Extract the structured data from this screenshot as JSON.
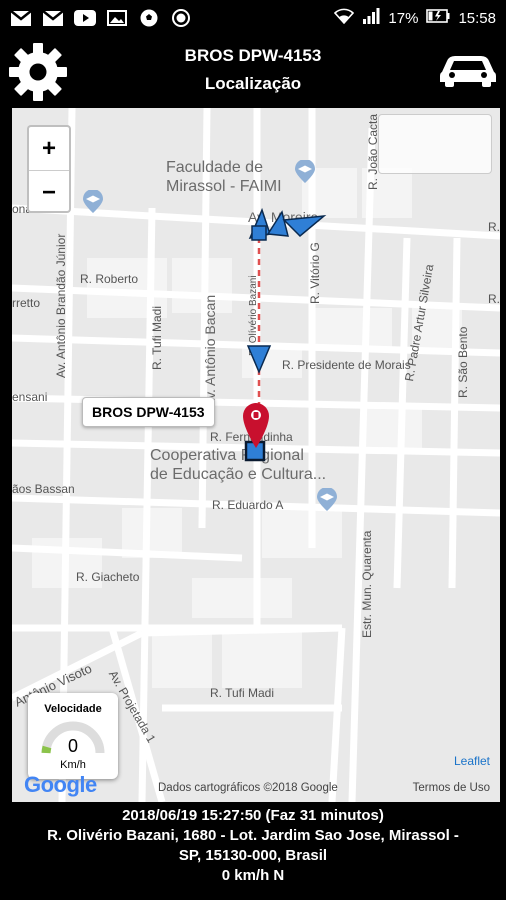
{
  "status_bar": {
    "left_icons": [
      "gmail-icon",
      "gmail-icon",
      "youtube-icon",
      "photos-icon",
      "soccer-ball-icon",
      "circle-app-icon"
    ],
    "battery": "17%",
    "time": "15:58"
  },
  "header": {
    "title": "BROS DPW-4153",
    "subtitle": "Localização"
  },
  "map": {
    "zoom_in": "+",
    "zoom_out": "−",
    "watermark": "",
    "poi": [
      {
        "name": "Faculdade de\nMirassol - FAIMI"
      },
      {
        "name": "Cooperativa Regional\nde Educação e Cultura..."
      }
    ],
    "streets": [
      "R. Roberto",
      "R. Tufi Madi",
      "Av. Antônio Brandão Júnior",
      "Av. Antônio Bacan",
      "R. Olívério Bazani",
      "R. Vitório G",
      "R. João Cacta",
      "R. Presidente de Morais",
      "R. Padre Artur Silveira",
      "R. São Bento",
      "R. Eduardo A",
      "Estr. Mun. Quarenta",
      "R. Tufi Madi",
      "Av. Projetada 1",
      "Antônio Visoto",
      "R. Giacheto",
      "Av. Moreira",
      "R. Fernandinha",
      "onarco",
      "rretto",
      "ensani",
      "ãos Bassan",
      "R."
    ],
    "marker_tooltip": "BROS DPW-4153",
    "speed_widget": {
      "label": "Velocidade",
      "value": "0",
      "unit": "Km/h"
    },
    "leaflet": "Leaflet",
    "attribution": "Dados cartográficos ©2018 Google",
    "terms": "Termos de Uso",
    "google_logo": "Google"
  },
  "footer": {
    "datetime": "2018/06/19 15:27:50 (Faz 31 minutos)",
    "address_line1": "R. Olivério Bazani, 1680 - Lot. Jardim Sao Jose, Mirassol -",
    "address_line2": "SP, 15130-000, Brasil",
    "speed_dir": "0 km/h N"
  },
  "colors": {
    "background": "#000000",
    "map_bg": "#eeeeee",
    "marker": "#c8102e",
    "route_dash": "#e05050",
    "arrow": "#2f7fd6",
    "leaflet_link": "#1a73c9"
  }
}
